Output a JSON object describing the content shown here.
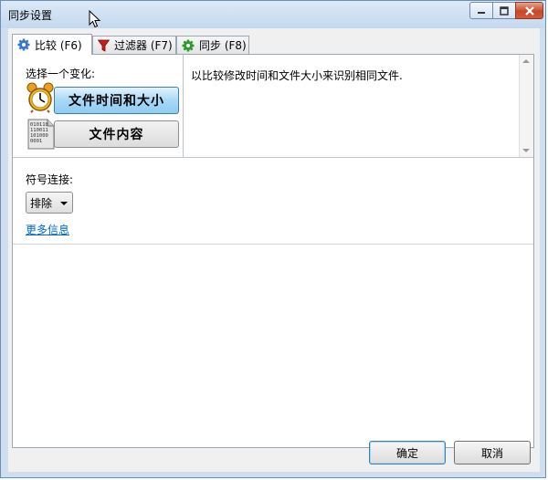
{
  "window": {
    "title": "同步设置"
  },
  "tabs": [
    {
      "label": "比较 (F6)",
      "icon": "gear-icon",
      "active": true
    },
    {
      "label": "过滤器 (F7)",
      "icon": "filter-icon",
      "active": false
    },
    {
      "label": "同步 (F8)",
      "icon": "sync-gear-icon",
      "active": false
    }
  ],
  "compare": {
    "choose_label": "选择一个变化:",
    "options": [
      {
        "label": "文件时间和大小",
        "icon": "alarm-clock-icon",
        "selected": true
      },
      {
        "label": "文件内容",
        "icon": "binary-file-icon",
        "selected": false
      }
    ],
    "description": "以比较修改时间和文件大小来识别相同文件."
  },
  "symlink": {
    "label": "符号连接:",
    "selected": "排除"
  },
  "more_info_link": "更多信息",
  "buttons": {
    "ok": "确定",
    "cancel": "取消"
  },
  "colors": {
    "accent": "#0066cc",
    "selected_button": "#8fcdf3",
    "close_button": "#c7472b"
  }
}
